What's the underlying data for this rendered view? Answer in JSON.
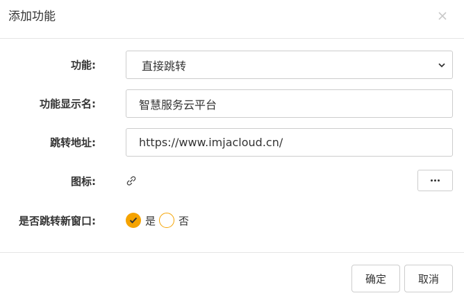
{
  "dialog": {
    "title": "添加功能",
    "close_icon": "close-icon"
  },
  "form": {
    "function": {
      "label": "功能:",
      "selected": "直接跳转"
    },
    "display_name": {
      "label": "功能显示名:",
      "value": "智慧服务云平台"
    },
    "url": {
      "label": "跳转地址:",
      "value": "https://www.imjacloud.cn/"
    },
    "icon": {
      "label": "图标:",
      "icon_name": "link-icon",
      "more_button_icon": "ellipsis-icon"
    },
    "new_window": {
      "label": "是否跳转新窗口:",
      "options": [
        "是",
        "否"
      ],
      "selected": "是"
    }
  },
  "footer": {
    "ok_label": "确定",
    "cancel_label": "取消"
  },
  "colors": {
    "accent": "#f5a300",
    "border": "#cccccc",
    "divider": "#e5e5e5",
    "text": "#333333"
  }
}
